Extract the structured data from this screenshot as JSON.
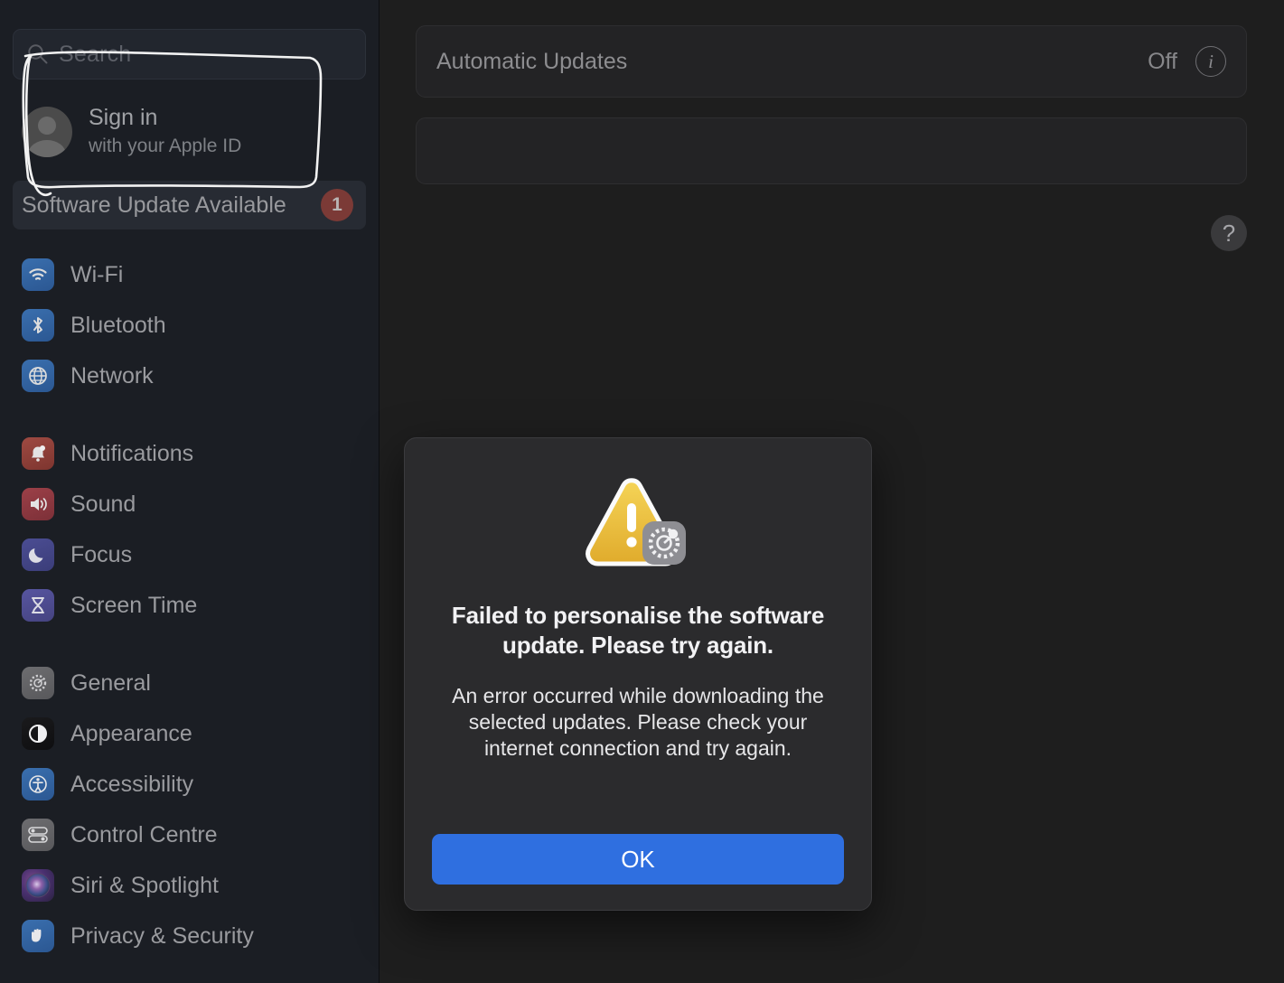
{
  "sidebar": {
    "search": {
      "placeholder": "Search",
      "icon": "search-icon"
    },
    "account": {
      "title": "Sign in",
      "subtitle": "with your Apple ID",
      "avatar_icon": "person-avatar-icon"
    },
    "update_banner": {
      "label": "Software Update Available",
      "badge": "1",
      "badge_color": "#7b3a36"
    },
    "groups": [
      {
        "items": [
          {
            "label": "Wi-Fi",
            "icon": "wifi-icon",
            "icon_class": "ic-wifi"
          },
          {
            "label": "Bluetooth",
            "icon": "bluetooth-icon",
            "icon_class": "ic-bluetooth"
          },
          {
            "label": "Network",
            "icon": "network-globe-icon",
            "icon_class": "ic-network"
          }
        ]
      },
      {
        "items": [
          {
            "label": "Notifications",
            "icon": "bell-icon",
            "icon_class": "ic-notif"
          },
          {
            "label": "Sound",
            "icon": "speaker-icon",
            "icon_class": "ic-sound"
          },
          {
            "label": "Focus",
            "icon": "moon-icon",
            "icon_class": "ic-focus"
          },
          {
            "label": "Screen Time",
            "icon": "hourglass-icon",
            "icon_class": "ic-screen"
          }
        ]
      },
      {
        "items": [
          {
            "label": "General",
            "icon": "gear-icon",
            "icon_class": "ic-general"
          },
          {
            "label": "Appearance",
            "icon": "contrast-icon",
            "icon_class": "ic-appear"
          },
          {
            "label": "Accessibility",
            "icon": "accessibility-icon",
            "icon_class": "ic-access"
          },
          {
            "label": "Control Centre",
            "icon": "toggles-icon",
            "icon_class": "ic-control"
          },
          {
            "label": "Siri & Spotlight",
            "icon": "siri-orb-icon",
            "icon_class": "ic-siri"
          },
          {
            "label": "Privacy & Security",
            "icon": "hand-icon",
            "icon_class": "ic-privacy"
          }
        ]
      }
    ]
  },
  "main": {
    "automatic_updates": {
      "label": "Automatic Updates",
      "value": "Off",
      "info_icon": "info-circle-icon"
    },
    "help_button": {
      "label": "?",
      "icon": "question-mark-icon"
    }
  },
  "dialog": {
    "icon": "warning-triangle-gear-icon",
    "title": "Failed to personalise the software update. Please try again.",
    "message": "An error occurred while downloading the selected updates. Please check your internet connection and try again.",
    "ok_label": "OK",
    "ok_color": "#2f6fe0"
  },
  "annotation": {
    "type": "hand-drawn-highlight",
    "color": "#ffffff",
    "target": "Sign in with your Apple ID"
  }
}
